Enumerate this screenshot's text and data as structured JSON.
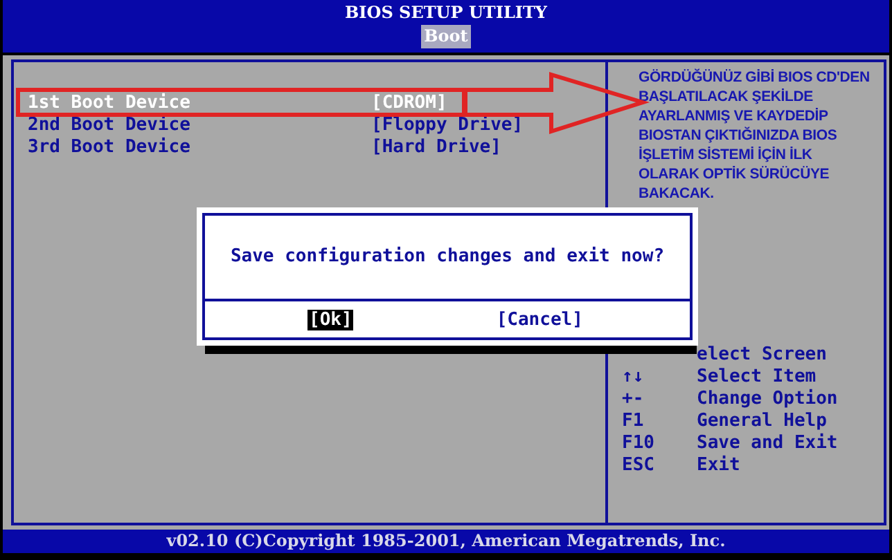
{
  "header": {
    "title": "BIOS SETUP UTILITY",
    "tabs": [
      {
        "label": "Boot",
        "selected": true
      }
    ]
  },
  "boot_devices": [
    {
      "label": "1st Boot Device",
      "value": "[CDROM]",
      "selected": true
    },
    {
      "label": "2nd Boot Device",
      "value": "[Floppy Drive]",
      "selected": false
    },
    {
      "label": "3rd Boot Device",
      "value": "[Hard Drive]",
      "selected": false
    }
  ],
  "note": [
    "GÖRDÜĞÜNÜZ GİBİ BIOS CD'DEN",
    "BAŞLATILACAK ŞEKİLDE",
    "AYARLANMIŞ VE KAYDEDİP",
    "BIOSTAN ÇIKTIĞINIZDA BIOS",
    "İŞLETİM SİSTEMİ İÇİN İLK",
    "OLARAK OPTİK SÜRÜCÜYE",
    "BAKACAK."
  ],
  "help": [
    {
      "action": "elect Screen"
    },
    {
      "key": "↑↓",
      "action": "Select Item"
    },
    {
      "key": "+-",
      "action": "Change Option"
    },
    {
      "key": "F1",
      "action": "General Help"
    },
    {
      "key": "F10",
      "action": "Save and Exit"
    },
    {
      "key": "ESC",
      "action": "Exit"
    }
  ],
  "dialog": {
    "message": "Save configuration changes and exit now?",
    "buttons": [
      {
        "label": "[Ok]",
        "selected": true
      },
      {
        "label": "[Cancel]",
        "selected": false
      }
    ]
  },
  "footer": "v02.10 (C)Copyright 1985-2001, American Megatrends, Inc."
}
